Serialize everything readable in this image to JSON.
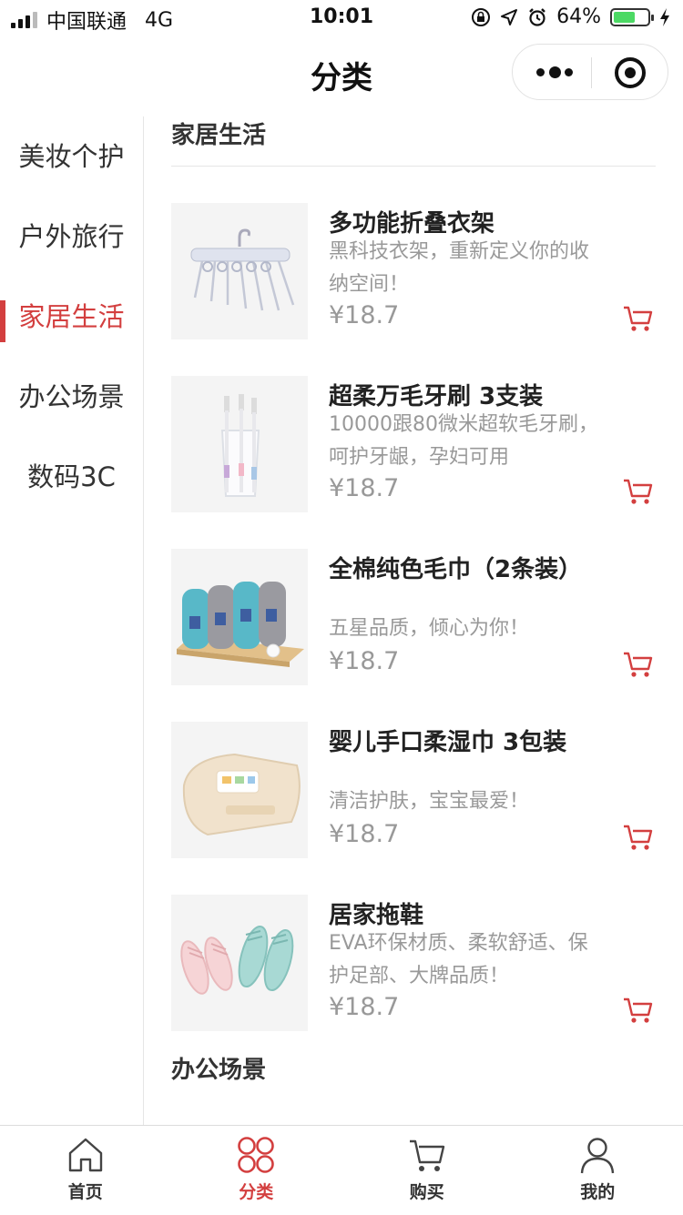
{
  "status_bar": {
    "carrier": "中国联通",
    "network": "4G",
    "time": "10:01",
    "battery": "64%",
    "battery_level": 0.64,
    "battery_color": "#4cd964"
  },
  "nav": {
    "title": "分类",
    "more_icon": "more-dots-icon",
    "close_icon": "target-circle-icon"
  },
  "theme": {
    "accent": "#d33f3f",
    "text_muted": "#999999"
  },
  "sidebar": {
    "items": [
      {
        "label": "美妆个护"
      },
      {
        "label": "户外旅行"
      },
      {
        "label": "家居生活",
        "active": true
      },
      {
        "label": "办公场景"
      },
      {
        "label": "数码3C"
      }
    ]
  },
  "sections": [
    {
      "title": "家居生活",
      "products": [
        {
          "name": "多功能折叠衣架",
          "desc": "黑科技衣架，重新定义你的收纳空间！",
          "price": "¥18.7",
          "icon": "hanger-image"
        },
        {
          "name": "超柔万毛牙刷 3支装",
          "desc": "10000跟80微米超软毛牙刷，呵护牙龈，孕妇可用",
          "price": "¥18.7",
          "icon": "toothbrush-image"
        },
        {
          "name": "全棉纯色毛巾（2条装）",
          "desc": "五星品质，倾心为你！",
          "price": "¥18.7",
          "icon": "towel-image"
        },
        {
          "name": "婴儿手口柔湿巾 3包装",
          "desc": "清洁护肤，宝宝最爱！",
          "price": "¥18.7",
          "icon": "wipes-image"
        },
        {
          "name": "居家拖鞋",
          "desc": "EVA环保材质、柔软舒适、保护足部、大牌品质！",
          "price": "¥18.7",
          "icon": "slippers-image"
        }
      ]
    },
    {
      "title": "办公场景"
    }
  ],
  "tabbar": {
    "tabs": [
      {
        "label": "首页",
        "icon": "home-icon"
      },
      {
        "label": "分类",
        "icon": "category-icon",
        "active": true
      },
      {
        "label": "购买",
        "icon": "cart-icon"
      },
      {
        "label": "我的",
        "icon": "user-icon"
      }
    ]
  }
}
